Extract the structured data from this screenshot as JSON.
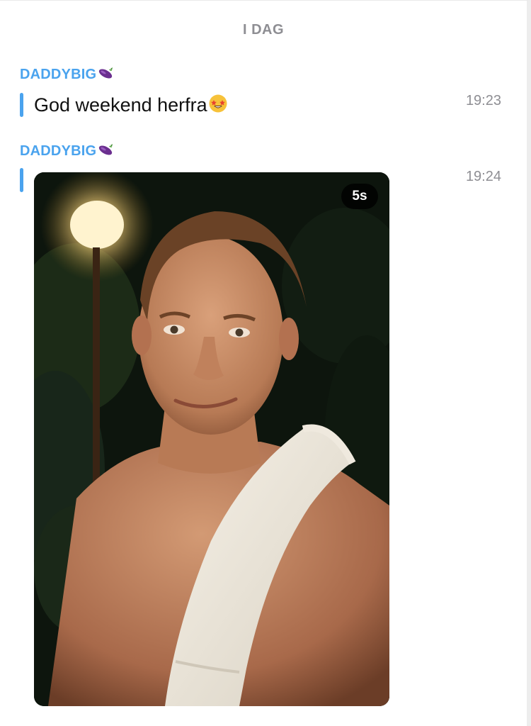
{
  "date_separator": "I DAG",
  "messages": [
    {
      "sender": "DADDYBIG",
      "sender_emoji": "eggplant-icon",
      "text": "God weekend herfra",
      "text_emoji": "star-struck-icon",
      "time": "19:23"
    },
    {
      "sender": "DADDYBIG",
      "sender_emoji": "eggplant-icon",
      "media_type": "video",
      "media_duration": "5s",
      "time": "19:24"
    }
  ],
  "colors": {
    "accent": "#4aa3ee",
    "muted": "#8e8e93",
    "text": "#111111",
    "background": "#ffffff"
  }
}
